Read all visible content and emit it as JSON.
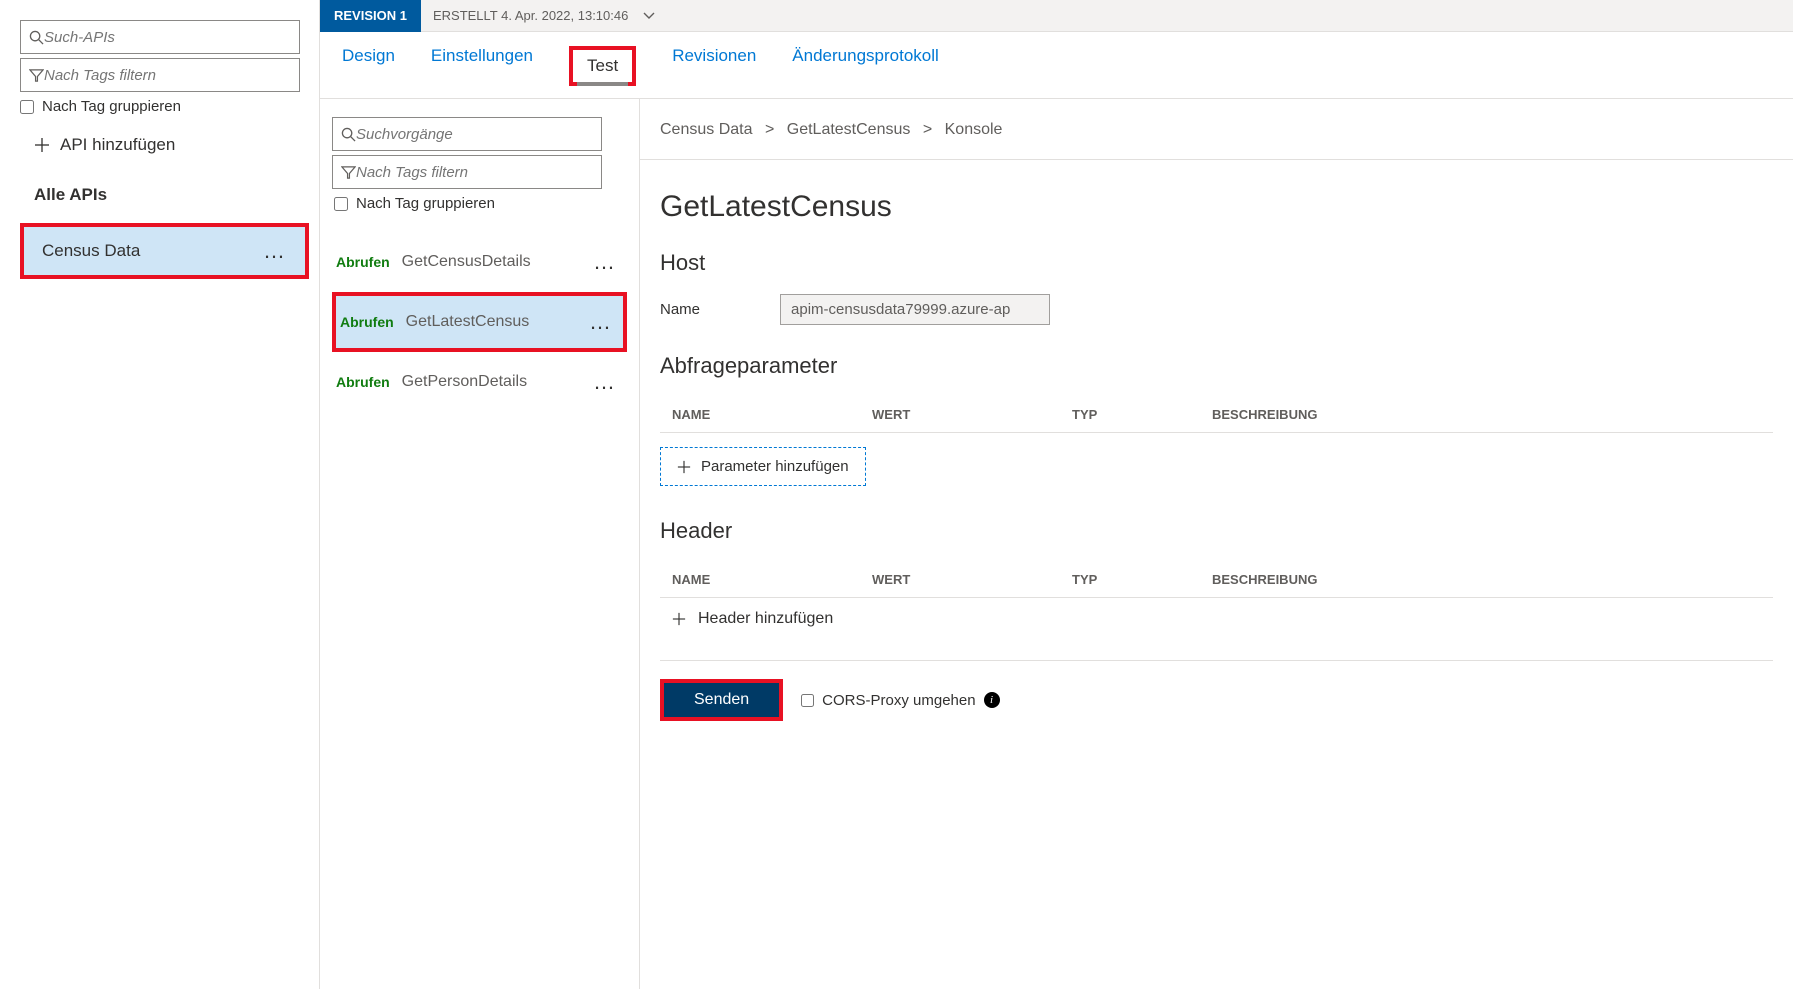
{
  "sidebar": {
    "search_placeholder": "Such-APIs",
    "filter_placeholder": "Nach Tags filtern",
    "group_by_tag": "Nach Tag gruppieren",
    "add_api": "API hinzufügen",
    "all_apis_label": "Alle APIs",
    "apis": [
      {
        "name": "Census Data",
        "selected": true
      }
    ]
  },
  "revision": {
    "badge": "REVISION 1",
    "created": "ERSTELLT 4. Apr. 2022, 13:10:46"
  },
  "tabs": {
    "design": "Design",
    "settings": "Einstellungen",
    "test": "Test",
    "revisions": "Revisionen",
    "changelog": "Änderungsprotokoll"
  },
  "ops": {
    "search_placeholder": "Suchvorgänge",
    "filter_placeholder": "Nach Tags filtern",
    "group_by_tag": "Nach Tag gruppieren",
    "method_label": "Abrufen",
    "items": [
      {
        "name": "GetCensusDetails",
        "selected": false
      },
      {
        "name": "GetLatestCensus",
        "selected": true
      },
      {
        "name": "GetPersonDetails",
        "selected": false
      }
    ]
  },
  "breadcrumb": {
    "a": "Census Data",
    "b": "GetLatestCensus",
    "c": "Konsole"
  },
  "detail": {
    "title": "GetLatestCensus",
    "host_heading": "Host",
    "host_name_label": "Name",
    "host_value": "apim-censusdata79999.azure-ap",
    "query_heading": "Abfrageparameter",
    "columns": {
      "name": "NAME",
      "value": "WERT",
      "type": "TYP",
      "desc": "BESCHREIBUNG"
    },
    "add_param": "Parameter hinzufügen",
    "header_heading": "Header",
    "add_header": "Header hinzufügen",
    "send": "Senden",
    "cors": "CORS-Proxy umgehen"
  }
}
